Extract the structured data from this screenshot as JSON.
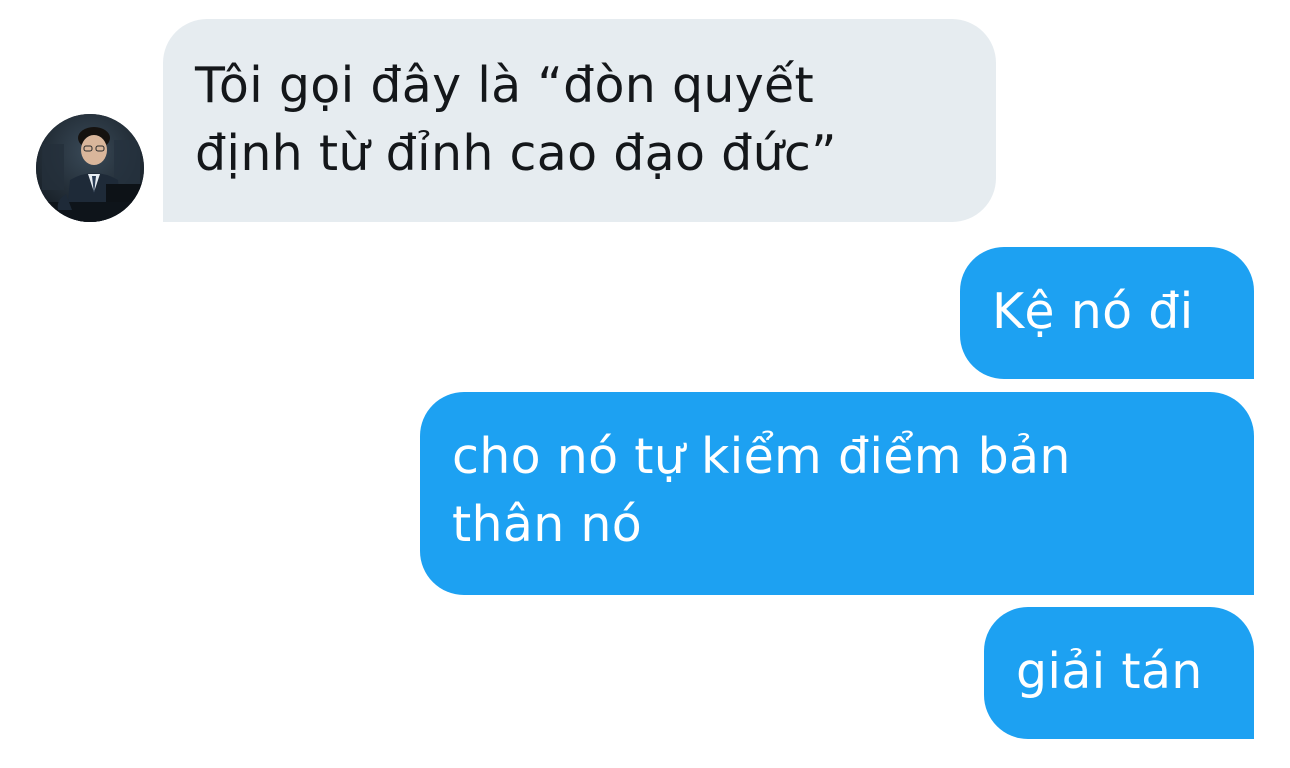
{
  "conversation": {
    "incoming": [
      {
        "text": "Tôi gọi đây là “đòn quyết\nđịnh từ đỉnh cao đạo đức”"
      }
    ],
    "outgoing": [
      {
        "text": "Kệ nó đi"
      },
      {
        "text": "cho nó tự kiểm điểm bản\nthân nó"
      },
      {
        "text": "giải tán"
      }
    ]
  },
  "colors": {
    "incoming_bubble": "#e6ecf0",
    "incoming_text": "#14171a",
    "outgoing_bubble": "#1da1f2",
    "outgoing_text": "#ffffff"
  },
  "icons": {
    "avatar": "user-avatar-photo"
  }
}
